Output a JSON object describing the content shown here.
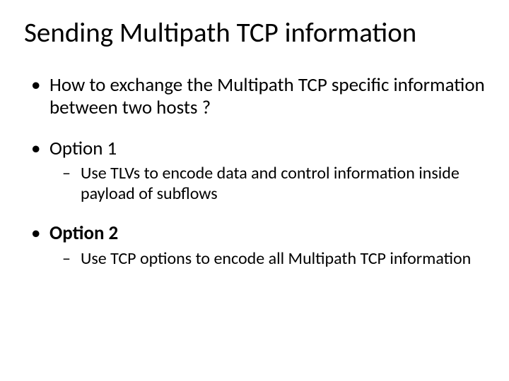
{
  "title": "Sending Multipath TCP information",
  "bullets": {
    "b1": "How to exchange the Multipath TCP specific information between two hosts ?",
    "b2": "Option 1",
    "b2_sub": "Use TLVs to encode data and control information inside payload of subflows",
    "b3": "Option 2",
    "b3_sub": "Use TCP options to encode all Multipath TCP information"
  }
}
